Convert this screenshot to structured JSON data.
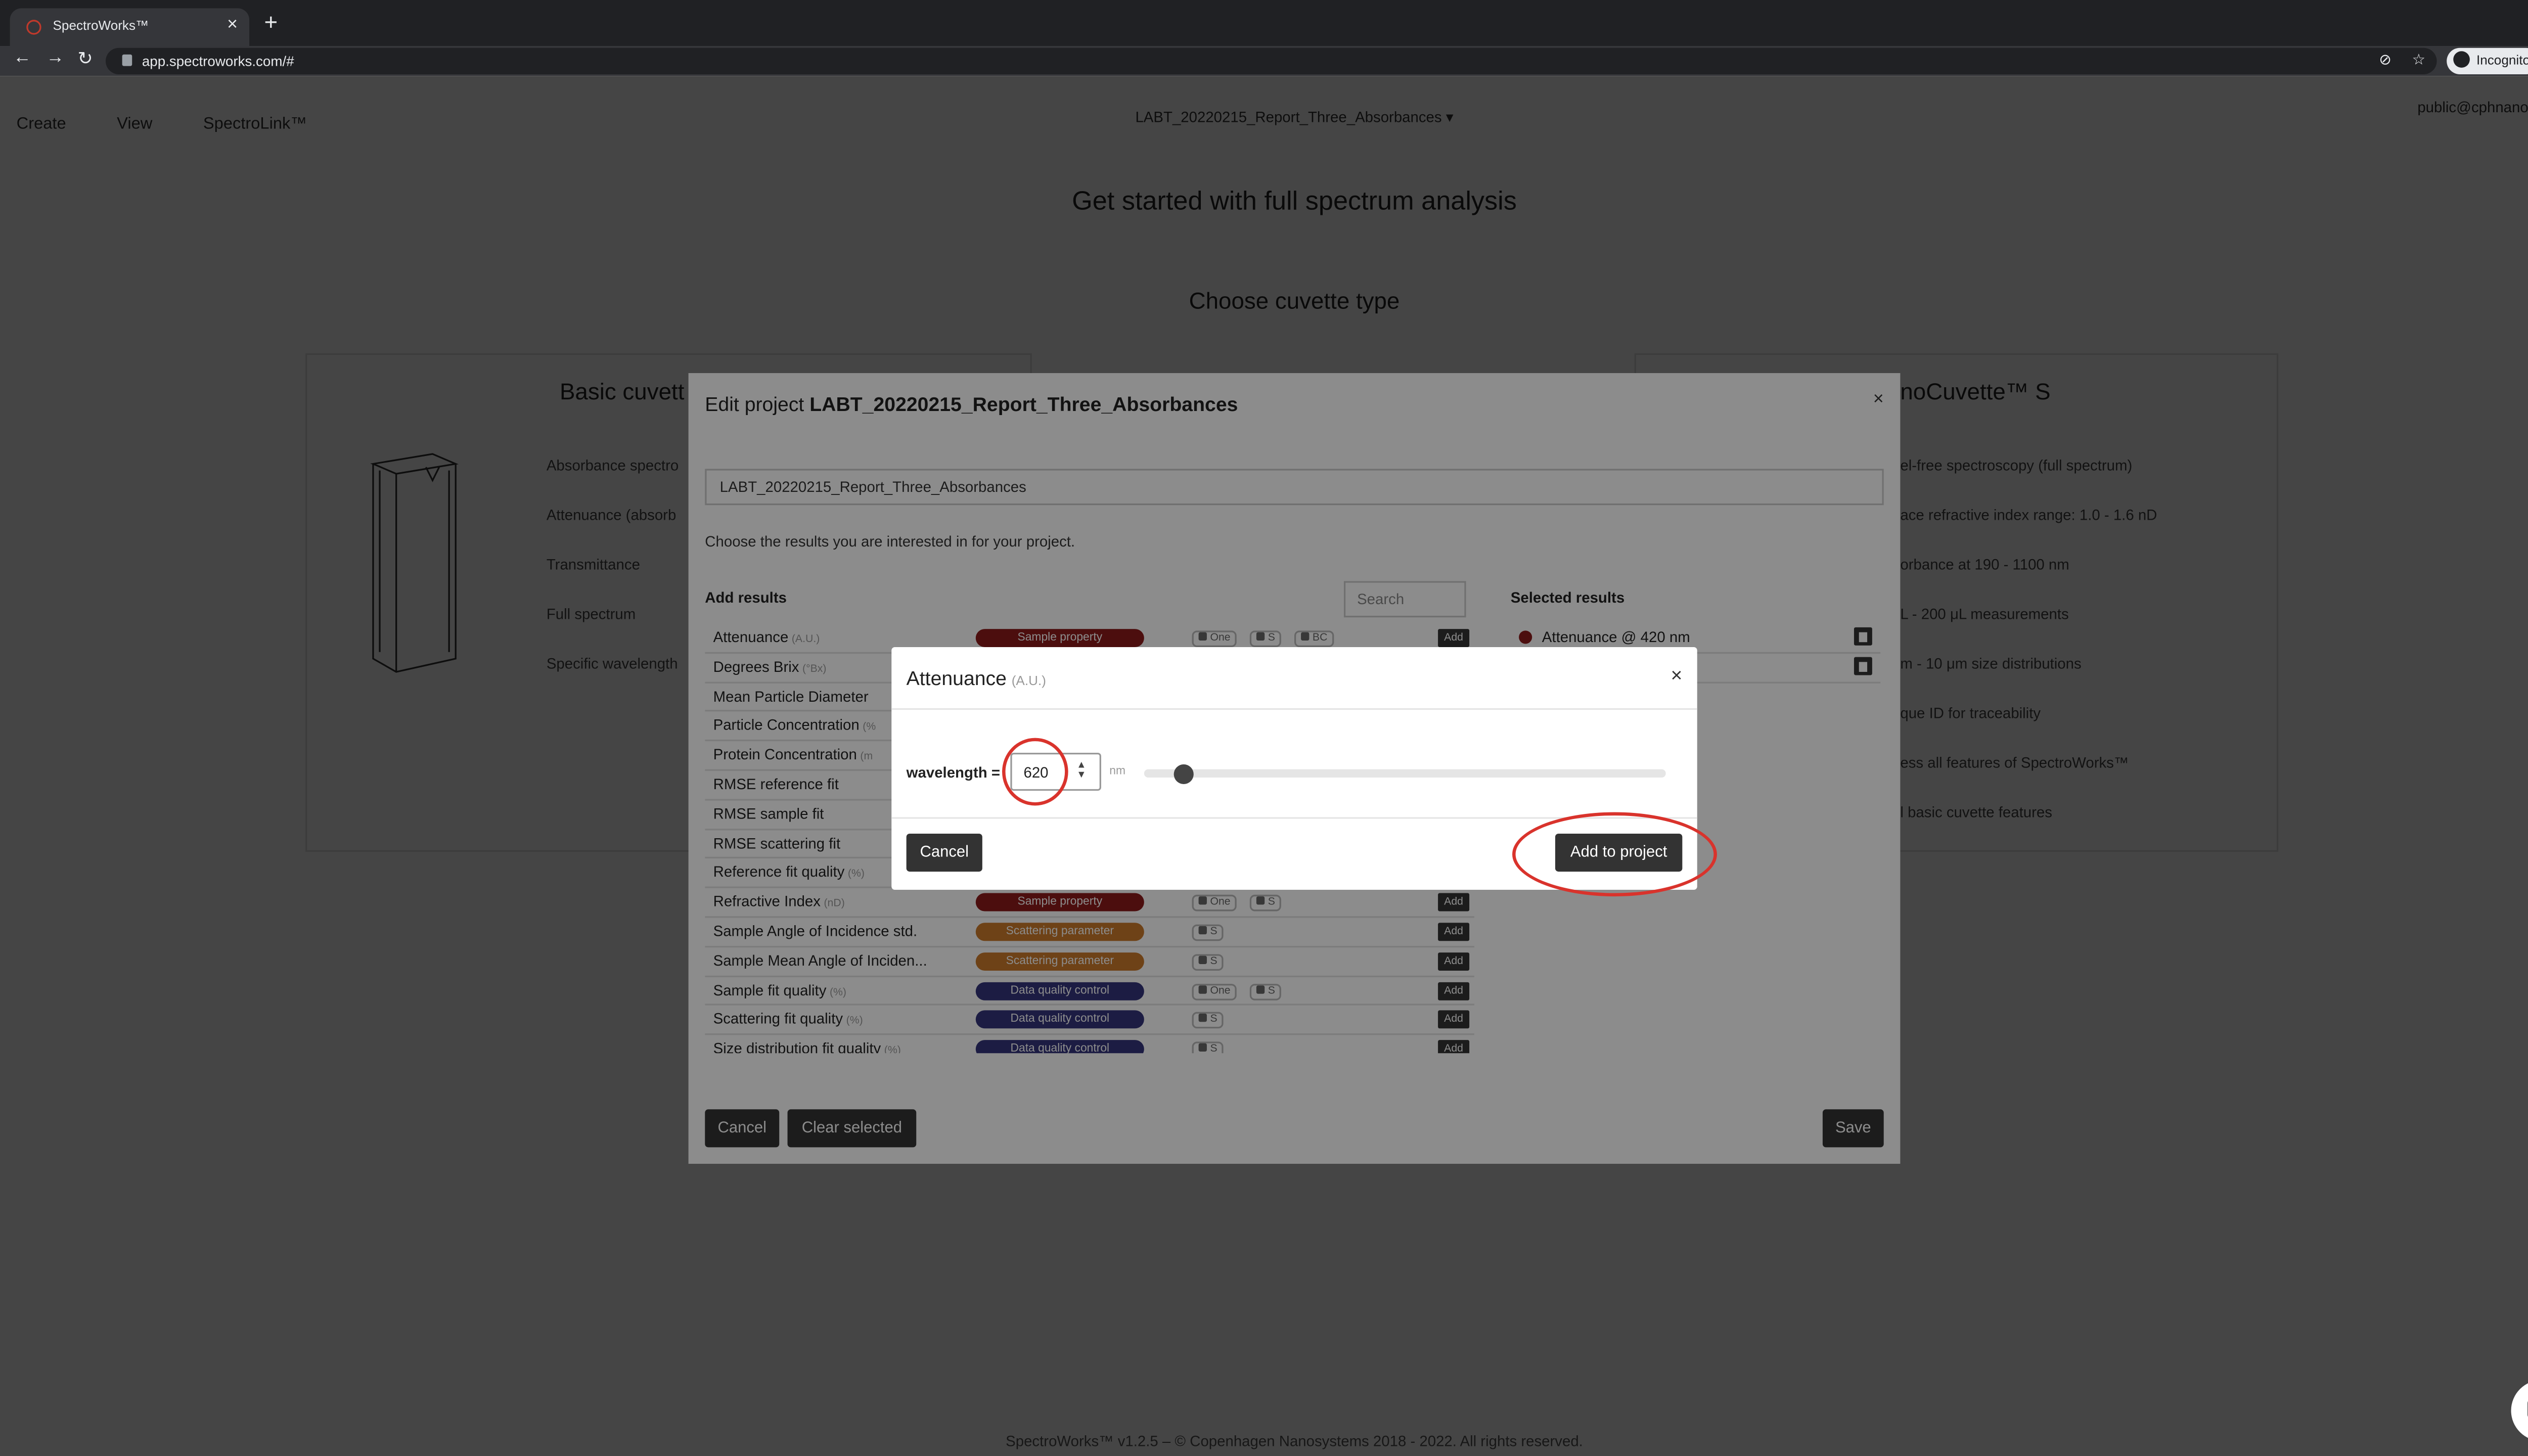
{
  "browser": {
    "tab_title": "SpectroWorks™",
    "url": "app.spectroworks.com/#",
    "incognito_label": "Incognito"
  },
  "topnav": {
    "items": [
      "Create",
      "View",
      "SpectroLink™"
    ],
    "project_selector": "LABT_20220215_Report_Three_Absorbances ▾",
    "user": "public@cphnano.com ▾"
  },
  "page": {
    "heading": "Get started with full spectrum analysis",
    "subheading": "Choose cuvette type",
    "left_card": {
      "title": "Basic cuvett",
      "features": [
        "Absorbance spectro",
        "Attenuance (absorb",
        "Transmittance",
        "Full spectrum",
        "Specific wavelength"
      ]
    },
    "right_card": {
      "title": "noCuvette™ S",
      "features": [
        "el-free spectroscopy (full spectrum)",
        "ace refractive index range: 1.0 - 1.6 nD",
        "orbance at 190 - 1100 nm",
        "L - 200 μL measurements",
        "m - 10 μm size distributions",
        "que ID for traceability",
        "ess all features of SpectroWorks™",
        "l basic cuvette features"
      ]
    },
    "footer": "SpectroWorks™ v1.2.5 – © Copenhagen Nanosystems 2018 - 2022. All rights reserved."
  },
  "edit_modal": {
    "title_prefix": "Edit project ",
    "title_name": "LABT_20220215_Report_Three_Absorbances",
    "close": "×",
    "project_name_value": "LABT_20220215_Report_Three_Absorbances",
    "description": "Choose the results you are interested in for your project.",
    "add_results_heading": "Add results",
    "search_placeholder": "Search",
    "selected_heading": "Selected results",
    "add_label": "Add",
    "rows": [
      {
        "name": "Attenuance",
        "unit": "(A.U.)",
        "category": "Sample property",
        "cat_color": "#8b1a1a",
        "tags": [
          "One",
          "S",
          "BC"
        ]
      },
      {
        "name": "Degrees Brix",
        "unit": "(°Bx)",
        "category": "",
        "cat_color": "",
        "tags": []
      },
      {
        "name": "Mean Particle Diameter",
        "unit": "",
        "category": "",
        "cat_color": "",
        "tags": []
      },
      {
        "name": "Particle Concentration",
        "unit": "(%",
        "category": "",
        "cat_color": "",
        "tags": []
      },
      {
        "name": "Protein Concentration",
        "unit": "(m",
        "category": "",
        "cat_color": "",
        "tags": []
      },
      {
        "name": "RMSE reference fit",
        "unit": "",
        "category": "",
        "cat_color": "",
        "tags": []
      },
      {
        "name": "RMSE sample fit",
        "unit": "",
        "category": "",
        "cat_color": "",
        "tags": []
      },
      {
        "name": "RMSE scattering fit",
        "unit": "",
        "category": "",
        "cat_color": "",
        "tags": []
      },
      {
        "name": "Reference fit quality",
        "unit": "(%)",
        "category": "",
        "cat_color": "",
        "tags": []
      },
      {
        "name": "Refractive Index",
        "unit": "(nD)",
        "category": "Sample property",
        "cat_color": "#8b1a1a",
        "tags": [
          "One",
          "S"
        ]
      },
      {
        "name": "Sample Angle of Incidence std.",
        "unit": "",
        "category": "Scattering parameter",
        "cat_color": "#c8782a",
        "tags": [
          "S"
        ]
      },
      {
        "name": "Sample Mean Angle of Inciden...",
        "unit": "",
        "category": "Scattering parameter",
        "cat_color": "#c8782a",
        "tags": [
          "S"
        ]
      },
      {
        "name": "Sample fit quality",
        "unit": "(%)",
        "category": "Data quality control",
        "cat_color": "#34347a",
        "tags": [
          "One",
          "S"
        ]
      },
      {
        "name": "Scattering fit quality",
        "unit": "(%)",
        "category": "Data quality control",
        "cat_color": "#34347a",
        "tags": [
          "S"
        ]
      },
      {
        "name": "Size distribution fit quality",
        "unit": "(%)",
        "category": "Data quality control",
        "cat_color": "#34347a",
        "tags": [
          "S"
        ]
      }
    ],
    "selected": [
      {
        "text": "Attenuance @ 420 nm",
        "dot_color": "#8b1a1a"
      },
      {
        "text": "",
        "dot_color": "#8b1a1a"
      }
    ],
    "cancel_label": "Cancel",
    "clear_label": "Clear selected",
    "save_label": "Save"
  },
  "dialog": {
    "title": "Attenuance",
    "unit": "(A.U.)",
    "close": "×",
    "wavelength_label": "wavelength =",
    "wavelength_value": "620",
    "wavelength_unit": "nm",
    "slider_fraction": 0.06,
    "cancel_label": "Cancel",
    "add_label": "Add to project"
  }
}
